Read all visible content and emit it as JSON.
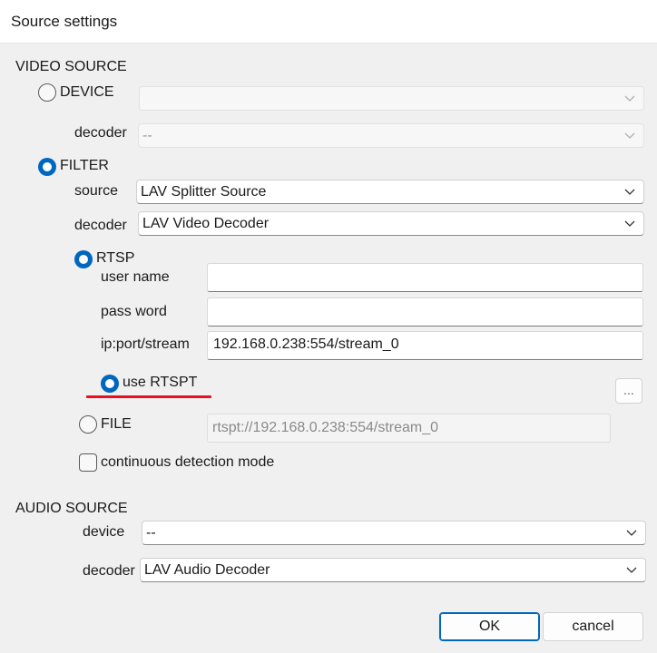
{
  "window": {
    "title": "Source settings"
  },
  "video_source": {
    "heading": "VIDEO SOURCE",
    "device": {
      "label": "DEVICE",
      "value": "",
      "decoder_label": "decoder",
      "decoder_value": "--"
    },
    "filter": {
      "label": "FILTER",
      "source_label": "source",
      "source_value": "LAV Splitter Source",
      "decoder_label": "decoder",
      "decoder_value": "LAV Video Decoder"
    },
    "rtsp": {
      "label": "RTSP",
      "user_label": "user name",
      "user_value": "",
      "pass_label": "pass word",
      "pass_value": "",
      "ip_label": "ip:port/stream",
      "ip_value": "192.168.0.238:554/stream_0",
      "use_rtspt_label": "use RTSPT"
    },
    "file": {
      "label": "FILE",
      "path": "rtspt://192.168.0.238:554/stream_0",
      "browse_label": "..."
    },
    "continuous_label": "continuous detection mode"
  },
  "audio_source": {
    "heading": "AUDIO SOURCE",
    "device_label": "device",
    "device_value": "--",
    "decoder_label": "decoder",
    "decoder_value": "LAV Audio Decoder"
  },
  "buttons": {
    "ok": "OK",
    "cancel": "cancel"
  },
  "colors": {
    "accent": "#0067c0",
    "highlight_underline": "#e81123"
  }
}
